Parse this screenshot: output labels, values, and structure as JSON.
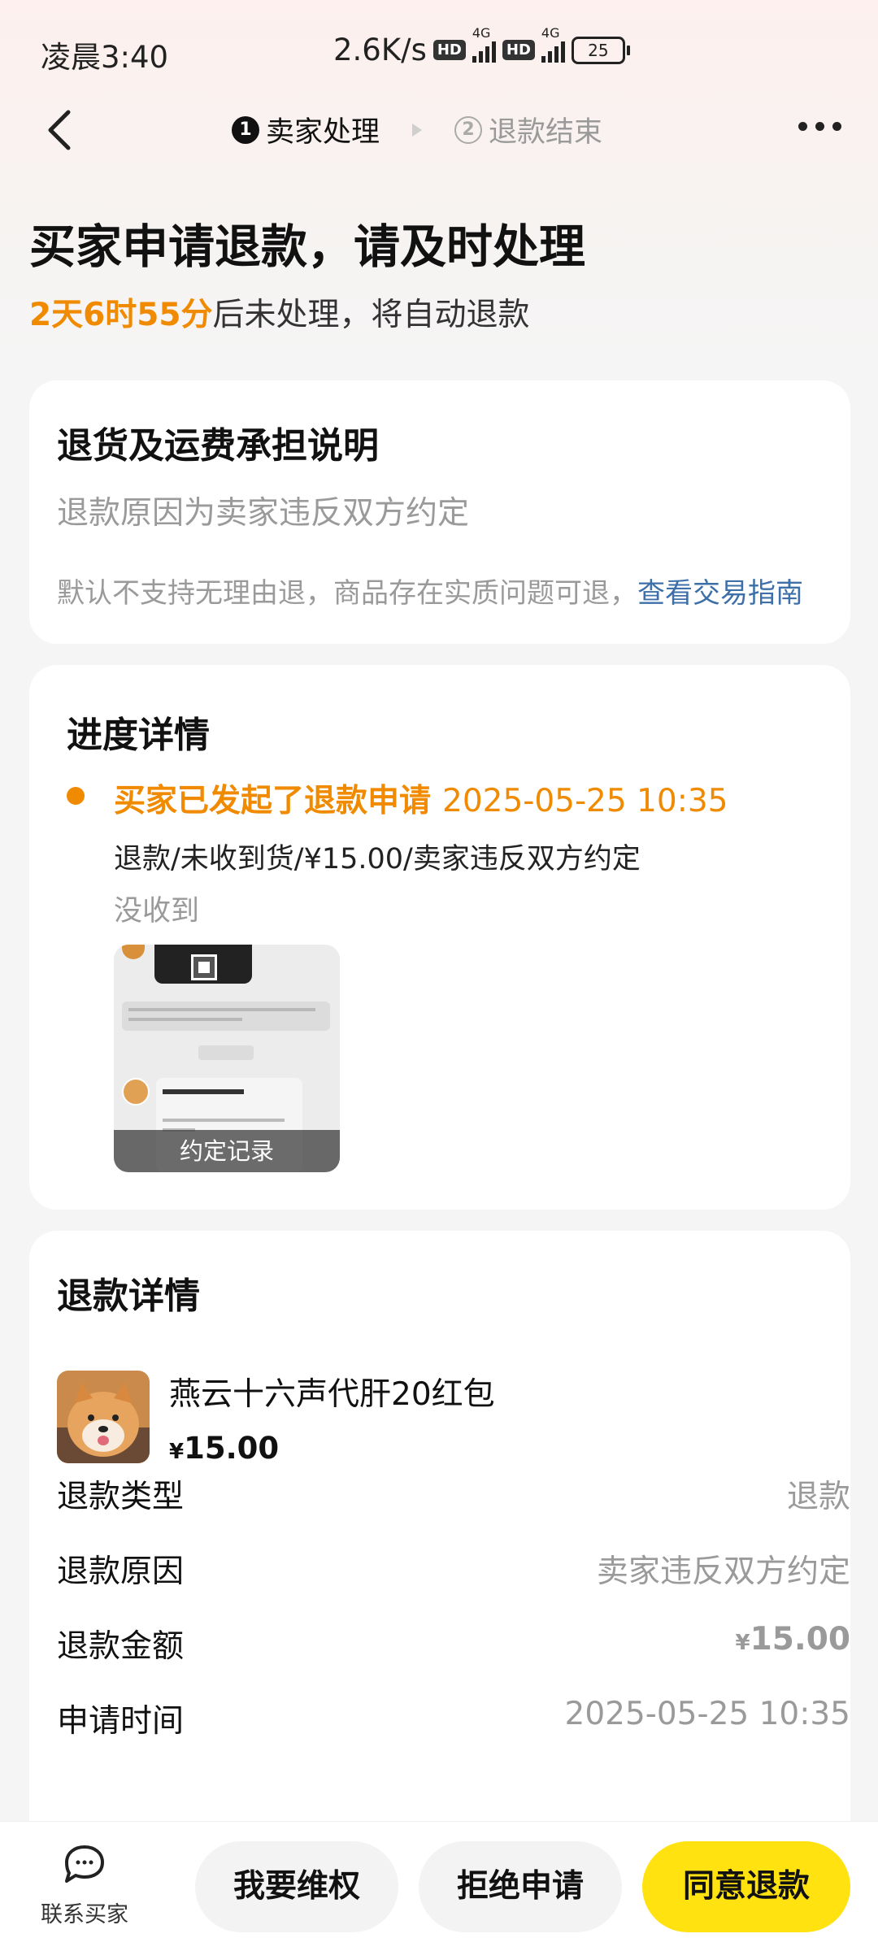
{
  "status_bar": {
    "time": "凌晨3:40",
    "speed": "2.6K/s",
    "hd": "HD",
    "network": "4G",
    "battery": "25"
  },
  "nav": {
    "step1_num": "1",
    "step1_label": "卖家处理",
    "step2_num": "2",
    "step2_label": "退款结束"
  },
  "header": {
    "title": "买家申请退款，请及时处理",
    "countdown": "2天6时55分",
    "countdown_suffix": "后未处理，将自动退款"
  },
  "policy_card": {
    "title": "退货及运费承担说明",
    "reason": "退款原因为卖家违反双方约定",
    "note": "默认不支持无理由退，商品存在实质问题可退，",
    "link": "查看交易指南"
  },
  "progress_card": {
    "title": "进度详情",
    "event": "买家已发起了退款申请",
    "event_time": "2025-05-25 10:35",
    "detail": "退款/未收到货/¥15.00/卖家违反双方约定",
    "note": "没收到",
    "thumbnail_caption": "约定记录"
  },
  "refund_card": {
    "title": "退款详情",
    "product": {
      "name": "燕云十六声代肝20红包",
      "currency": "¥",
      "price": "15.00"
    },
    "rows": [
      {
        "label": "退款类型",
        "value": "退款"
      },
      {
        "label": "退款原因",
        "value": "卖家违反双方约定"
      },
      {
        "label": "退款金额",
        "currency": "¥",
        "value": "15.00"
      },
      {
        "label": "申请时间",
        "value": "2025-05-25 10:35"
      }
    ]
  },
  "bottom_bar": {
    "contact_label": "联系买家",
    "btn_rights": "我要维权",
    "btn_reject": "拒绝申请",
    "btn_agree": "同意退款"
  },
  "colors": {
    "accent_orange": "#f08a00",
    "link_blue": "#3d6fa8",
    "agree_yellow": "#ffe20f"
  }
}
